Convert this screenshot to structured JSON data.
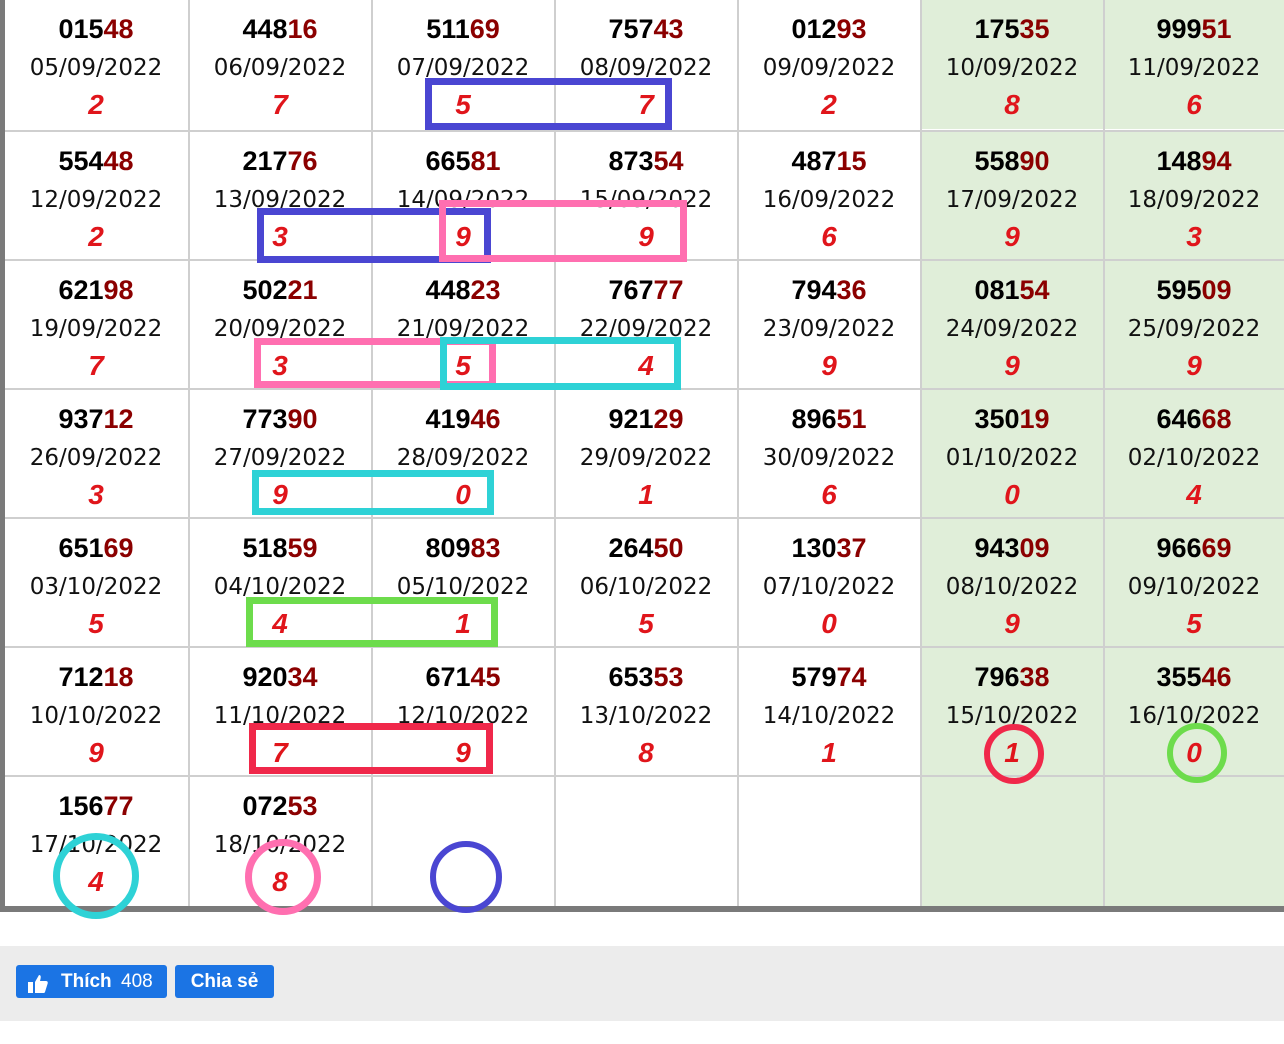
{
  "rows": [
    [
      {
        "head": "015",
        "tail": "48",
        "date": "05/09/2022",
        "digit": "2"
      },
      {
        "head": "448",
        "tail": "16",
        "date": "06/09/2022",
        "digit": "7"
      },
      {
        "head": "511",
        "tail": "69",
        "date": "07/09/2022",
        "digit": "5"
      },
      {
        "head": "757",
        "tail": "43",
        "date": "08/09/2022",
        "digit": "7"
      },
      {
        "head": "012",
        "tail": "93",
        "date": "09/09/2022",
        "digit": "2"
      },
      {
        "head": "175",
        "tail": "35",
        "date": "10/09/2022",
        "digit": "8"
      },
      {
        "head": "999",
        "tail": "51",
        "date": "11/09/2022",
        "digit": "6"
      }
    ],
    [
      {
        "head": "554",
        "tail": "48",
        "date": "12/09/2022",
        "digit": "2"
      },
      {
        "head": "217",
        "tail": "76",
        "date": "13/09/2022",
        "digit": "3"
      },
      {
        "head": "665",
        "tail": "81",
        "date": "14/09/2022",
        "digit": "9"
      },
      {
        "head": "873",
        "tail": "54",
        "date": "15/09/2022",
        "digit": "9"
      },
      {
        "head": "487",
        "tail": "15",
        "date": "16/09/2022",
        "digit": "6"
      },
      {
        "head": "558",
        "tail": "90",
        "date": "17/09/2022",
        "digit": "9"
      },
      {
        "head": "148",
        "tail": "94",
        "date": "18/09/2022",
        "digit": "3"
      }
    ],
    [
      {
        "head": "621",
        "tail": "98",
        "date": "19/09/2022",
        "digit": "7"
      },
      {
        "head": "502",
        "tail": "21",
        "date": "20/09/2022",
        "digit": "3"
      },
      {
        "head": "448",
        "tail": "23",
        "date": "21/09/2022",
        "digit": "5"
      },
      {
        "head": "767",
        "tail": "77",
        "date": "22/09/2022",
        "digit": "4"
      },
      {
        "head": "794",
        "tail": "36",
        "date": "23/09/2022",
        "digit": "9"
      },
      {
        "head": "081",
        "tail": "54",
        "date": "24/09/2022",
        "digit": "9"
      },
      {
        "head": "595",
        "tail": "09",
        "date": "25/09/2022",
        "digit": "9"
      }
    ],
    [
      {
        "head": "937",
        "tail": "12",
        "date": "26/09/2022",
        "digit": "3"
      },
      {
        "head": "773",
        "tail": "90",
        "date": "27/09/2022",
        "digit": "9"
      },
      {
        "head": "419",
        "tail": "46",
        "date": "28/09/2022",
        "digit": "0"
      },
      {
        "head": "921",
        "tail": "29",
        "date": "29/09/2022",
        "digit": "1"
      },
      {
        "head": "896",
        "tail": "51",
        "date": "30/09/2022",
        "digit": "6"
      },
      {
        "head": "350",
        "tail": "19",
        "date": "01/10/2022",
        "digit": "0"
      },
      {
        "head": "646",
        "tail": "68",
        "date": "02/10/2022",
        "digit": "4"
      }
    ],
    [
      {
        "head": "651",
        "tail": "69",
        "date": "03/10/2022",
        "digit": "5"
      },
      {
        "head": "518",
        "tail": "59",
        "date": "04/10/2022",
        "digit": "4"
      },
      {
        "head": "809",
        "tail": "83",
        "date": "05/10/2022",
        "digit": "1"
      },
      {
        "head": "264",
        "tail": "50",
        "date": "06/10/2022",
        "digit": "5"
      },
      {
        "head": "130",
        "tail": "37",
        "date": "07/10/2022",
        "digit": "0"
      },
      {
        "head": "943",
        "tail": "09",
        "date": "08/10/2022",
        "digit": "9"
      },
      {
        "head": "966",
        "tail": "69",
        "date": "09/10/2022",
        "digit": "5"
      }
    ],
    [
      {
        "head": "712",
        "tail": "18",
        "date": "10/10/2022",
        "digit": "9"
      },
      {
        "head": "920",
        "tail": "34",
        "date": "11/10/2022",
        "digit": "7"
      },
      {
        "head": "671",
        "tail": "45",
        "date": "12/10/2022",
        "digit": "9"
      },
      {
        "head": "653",
        "tail": "53",
        "date": "13/10/2022",
        "digit": "8"
      },
      {
        "head": "579",
        "tail": "74",
        "date": "14/10/2022",
        "digit": "1"
      },
      {
        "head": "796",
        "tail": "38",
        "date": "15/10/2022",
        "digit": "1"
      },
      {
        "head": "355",
        "tail": "46",
        "date": "16/10/2022",
        "digit": "0"
      }
    ],
    [
      {
        "head": "156",
        "tail": "77",
        "date": "17/10/2022",
        "digit": "4"
      },
      {
        "head": "072",
        "tail": "53",
        "date": "18/10/2022",
        "digit": "8"
      },
      null,
      null,
      null,
      null,
      null
    ]
  ],
  "colors": {
    "head": "#000000",
    "tail": "#8b0000",
    "digit": "#e0151b",
    "weekend_bg": "#e0eed9",
    "grid_line": "#cfcfcf",
    "frame": "#7a7a7a",
    "mark_blue": "#4a46d2",
    "mark_pink": "#ff6fb0",
    "mark_cyan": "#2ed2d6",
    "mark_green": "#6ddc4c",
    "mark_red": "#f0284a",
    "fb_blue": "#1b74e4"
  },
  "footer": {
    "like_icon": "thumbs-up-icon",
    "like_label": "Thích",
    "like_count": "408",
    "share_label": "Chia sẻ"
  }
}
